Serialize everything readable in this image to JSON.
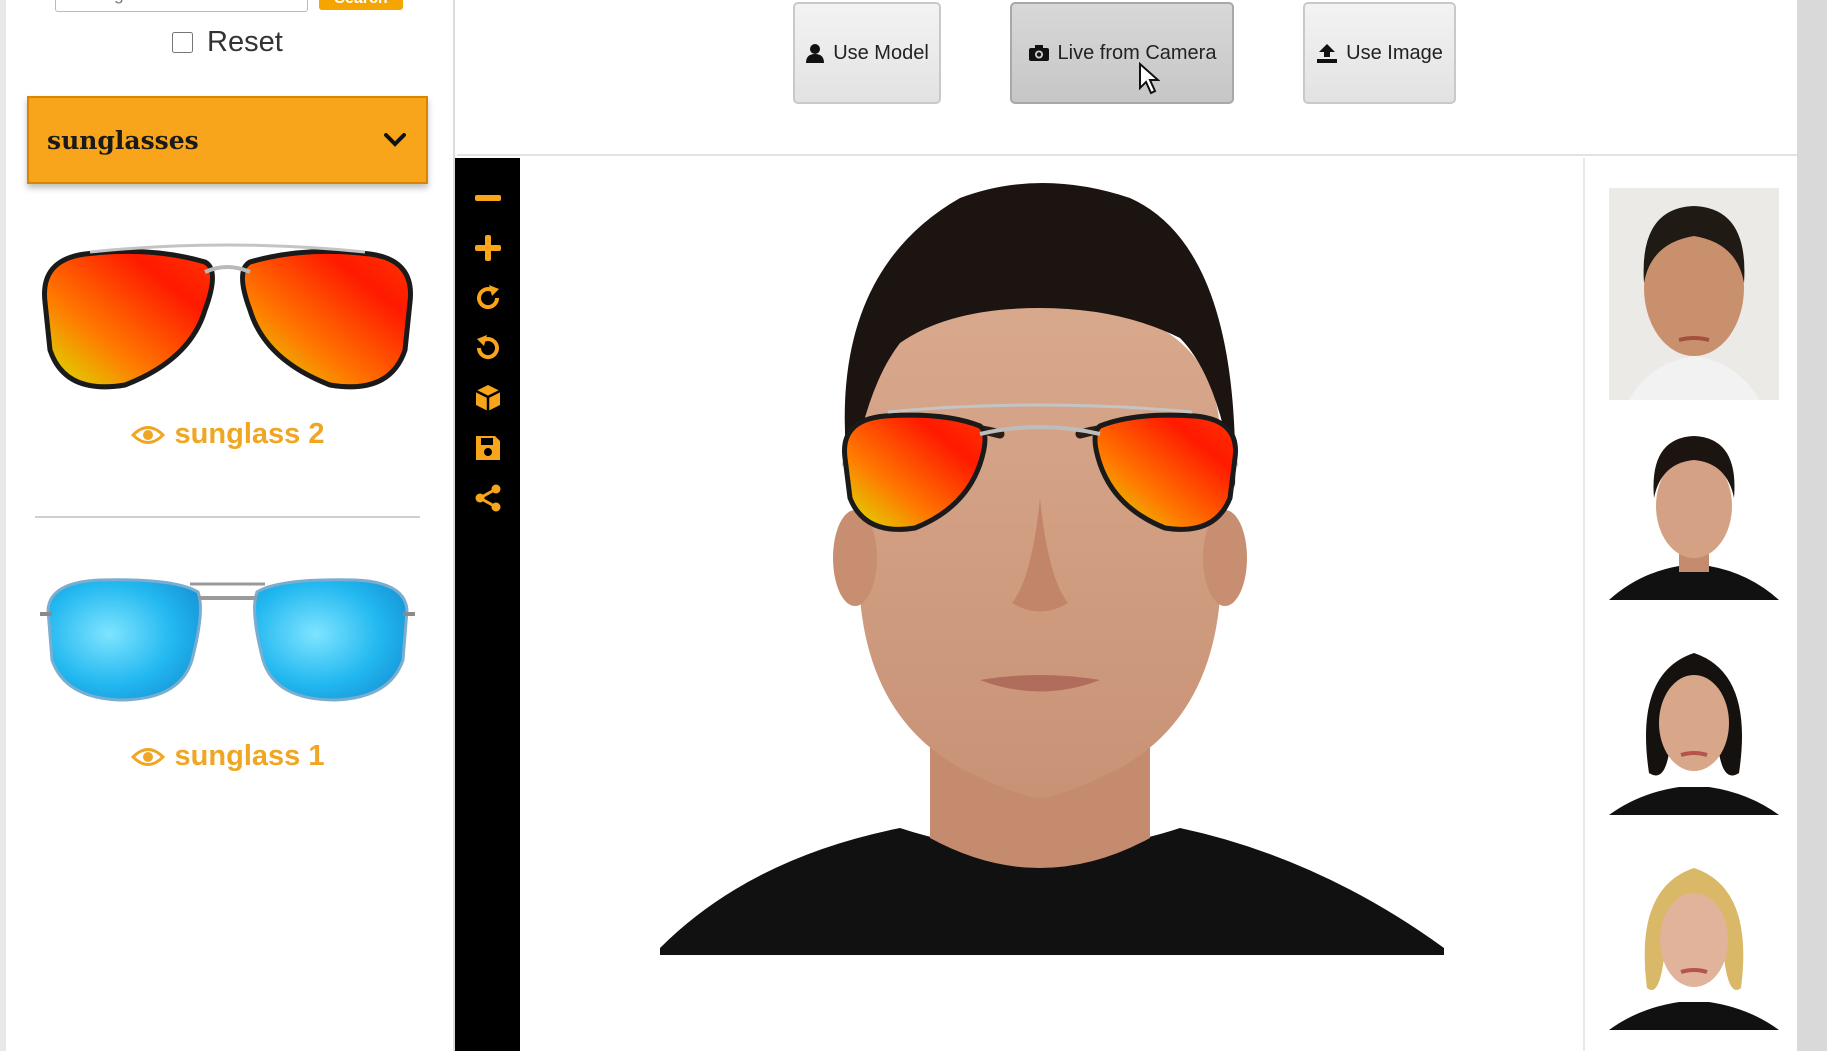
{
  "sidebar": {
    "search": {
      "placeholder": "Looking for...",
      "button_label": "Search"
    },
    "reset_label": "Reset",
    "category": {
      "selected": "sunglasses"
    },
    "products": [
      {
        "name": "sunglass 2",
        "lens_color": "red-orange mirror aviator"
      },
      {
        "name": "sunglass 1",
        "lens_color": "blue mirror square"
      }
    ]
  },
  "actions": {
    "use_model": "Use Model",
    "live_camera": "Live from Camera",
    "use_image": "Use Image"
  },
  "toolbar": {
    "icons": [
      "minus-icon",
      "plus-icon",
      "rotate-right-icon",
      "rotate-left-icon",
      "cube-icon",
      "save-icon",
      "share-icon"
    ]
  },
  "models": [
    "male model 1",
    "male model 2",
    "female model 1",
    "female model 2"
  ],
  "colors": {
    "accent": "#f8a51b",
    "link": "#f0a623",
    "toolbar": "#000000"
  }
}
